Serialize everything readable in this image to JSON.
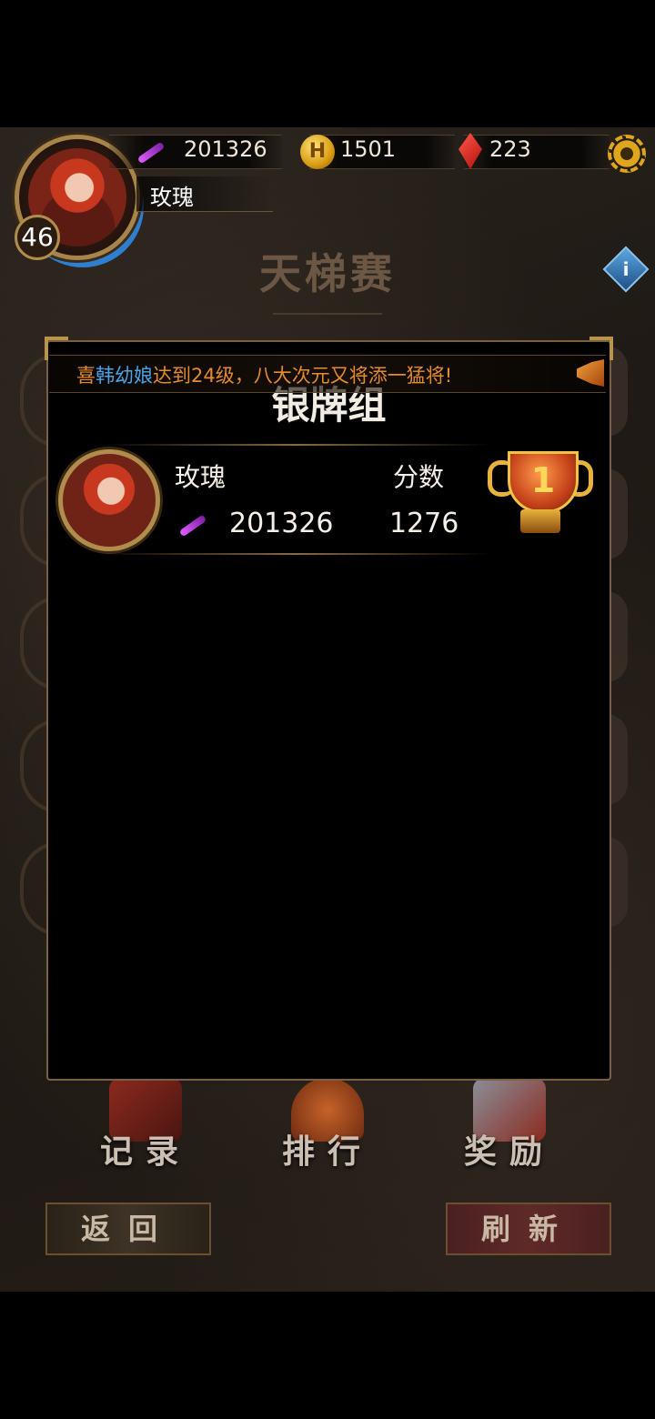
{
  "player": {
    "level": "46",
    "name": "玫瑰",
    "power": "201326",
    "gold": "1501",
    "gems": "223"
  },
  "page_title": "天梯赛",
  "menu": [
    {
      "label": "记录"
    },
    {
      "label": "排行"
    },
    {
      "label": "奖励"
    }
  ],
  "buttons": {
    "back": "返回",
    "refresh": "刷新"
  },
  "ticker": {
    "prefix": "喜",
    "highlight_name": "韩幼娘",
    "message": "达到24级，八大次元又将添一猛将!"
  },
  "modal": {
    "title": "银牌组",
    "score_header": "分数",
    "entries": [
      {
        "name": "玫瑰",
        "power": "201326",
        "score": "1276",
        "rank": "1"
      }
    ]
  },
  "icons": {
    "power": "feather-icon",
    "gold": "coin-icon",
    "gems": "gem-icon",
    "settings": "gear-icon",
    "info": "info-icon",
    "announce": "horn-icon",
    "rank": "trophy-icon"
  },
  "colors": {
    "ticker_text": "#e58b2c",
    "ticker_highlight": "#4aa4e8",
    "frame_gold": "#b18d4d"
  }
}
